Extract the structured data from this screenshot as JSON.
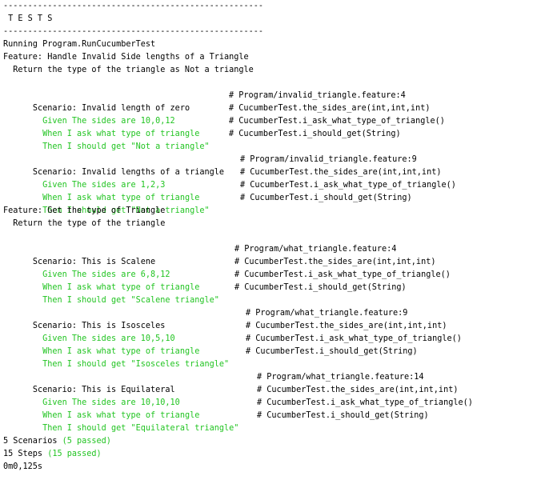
{
  "colors": {
    "text": "#000000",
    "passed": "#22c422",
    "background": "#ffffff"
  },
  "header": {
    "separator_top": "-----------------------------------------------------",
    "title": " T E S T S",
    "separator_bottom": "-----------------------------------------------------"
  },
  "running": "Running Program.RunCucumberTest",
  "feature1": {
    "title": "Feature: Handle Invalid Side lengths of a Triangle",
    "description": "  Return the type of the triangle as Not a triangle",
    "scenario1": {
      "title": "  Scenario: Invalid length of zero",
      "title_comment": "# Program/invalid_triangle.feature:4",
      "step1": "    Given The sides are 10,0,12",
      "step1_comment": "# CucumberTest.the_sides_are(int,int,int)",
      "step2": "    When I ask what type of triangle",
      "step2_comment": "# CucumberTest.i_ask_what_type_of_triangle()",
      "step3": "    Then I should get \"Not a triangle\"",
      "step3_comment": "# CucumberTest.i_should_get(String)"
    },
    "scenario2": {
      "title": "  Scenario: Invalid lengths of a triangle",
      "title_comment": "# Program/invalid_triangle.feature:9",
      "step1": "    Given The sides are 1,2,3",
      "step1_comment": "# CucumberTest.the_sides_are(int,int,int)",
      "step2": "    When I ask what type of triangle",
      "step2_comment": "# CucumberTest.i_ask_what_type_of_triangle()",
      "step3": "    Then I should get \"Not a triangle\"",
      "step3_comment": "# CucumberTest.i_should_get(String)"
    }
  },
  "feature2": {
    "title": "Feature: Get the type of Triangle",
    "description": "  Return the type of the triangle",
    "scenario1": {
      "title": "  Scenario: This is Scalene",
      "title_comment": "# Program/what_triangle.feature:4",
      "step1": "    Given The sides are 6,8,12",
      "step1_comment": "# CucumberTest.the_sides_are(int,int,int)",
      "step2": "    When I ask what type of triangle",
      "step2_comment": "# CucumberTest.i_ask_what_type_of_triangle()",
      "step3": "    Then I should get \"Scalene triangle\"",
      "step3_comment": "# CucumberTest.i_should_get(String)"
    },
    "scenario2": {
      "title": "  Scenario: This is Isosceles",
      "title_comment": "# Program/what_triangle.feature:9",
      "step1": "    Given The sides are 10,5,10",
      "step1_comment": "# CucumberTest.the_sides_are(int,int,int)",
      "step2": "    When I ask what type of triangle",
      "step2_comment": "# CucumberTest.i_ask_what_type_of_triangle()",
      "step3": "    Then I should get \"Isosceles triangle\"",
      "step3_comment": "# CucumberTest.i_should_get(String)"
    },
    "scenario3": {
      "title": "  Scenario: This is Equilateral",
      "title_comment": "# Program/what_triangle.feature:14",
      "step1": "    Given The sides are 10,10,10",
      "step1_comment": "# CucumberTest.the_sides_are(int,int,int)",
      "step2": "    When I ask what type of triangle",
      "step2_comment": "# CucumberTest.i_ask_what_type_of_triangle()",
      "step3": "    Then I should get \"Equilateral triangle\"",
      "step3_comment": "# CucumberTest.i_should_get(String)"
    }
  },
  "summary": {
    "scenarios_label": "5 Scenarios ",
    "scenarios_passed": "(5 passed)",
    "steps_label": "15 Steps ",
    "steps_passed": "(15 passed)",
    "duration": "0m0,125s"
  }
}
